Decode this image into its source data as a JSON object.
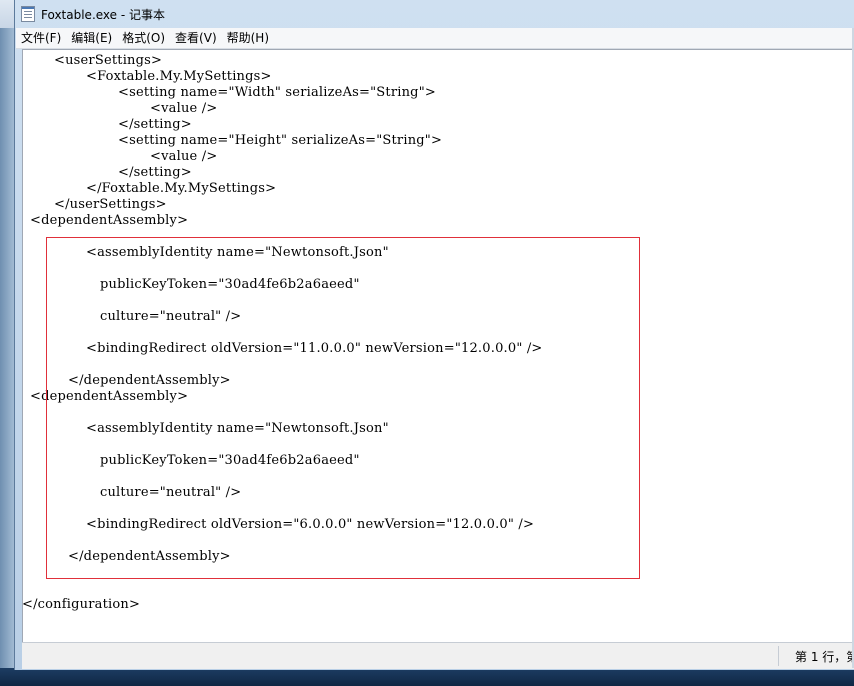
{
  "window": {
    "title": "Foxtable.exe - 记事本"
  },
  "menu": {
    "file": "文件(F)",
    "edit": "编辑(E)",
    "format": "格式(O)",
    "view": "查看(V)",
    "help": "帮助(H)"
  },
  "lines": [
    "<userSettings>",
    "<Foxtable.My.MySettings>",
    "<setting name=\"Width\" serializeAs=\"String\">",
    "<value />",
    "</setting>",
    "<setting name=\"Height\" serializeAs=\"String\">",
    "<value />",
    "</setting>",
    "</Foxtable.My.MySettings>",
    "</userSettings>",
    "<dependentAssembly>",
    "<assemblyIdentity name=\"Newtonsoft.Json\"",
    "publicKeyToken=\"30ad4fe6b2a6aeed\"",
    "culture=\"neutral\" />",
    "<bindingRedirect oldVersion=\"11.0.0.0\" newVersion=\"12.0.0.0\" />",
    "</dependentAssembly>",
    "<dependentAssembly>",
    "<assemblyIdentity name=\"Newtonsoft.Json\"",
    "publicKeyToken=\"30ad4fe6b2a6aeed\"",
    "culture=\"neutral\" />",
    "<bindingRedirect oldVersion=\"6.0.0.0\" newVersion=\"12.0.0.0\" />",
    "</dependentAssembly>",
    "</configuration>"
  ],
  "status": {
    "position": "第 1 行，第"
  },
  "colors": {
    "highlight_border": "#e0303a"
  }
}
